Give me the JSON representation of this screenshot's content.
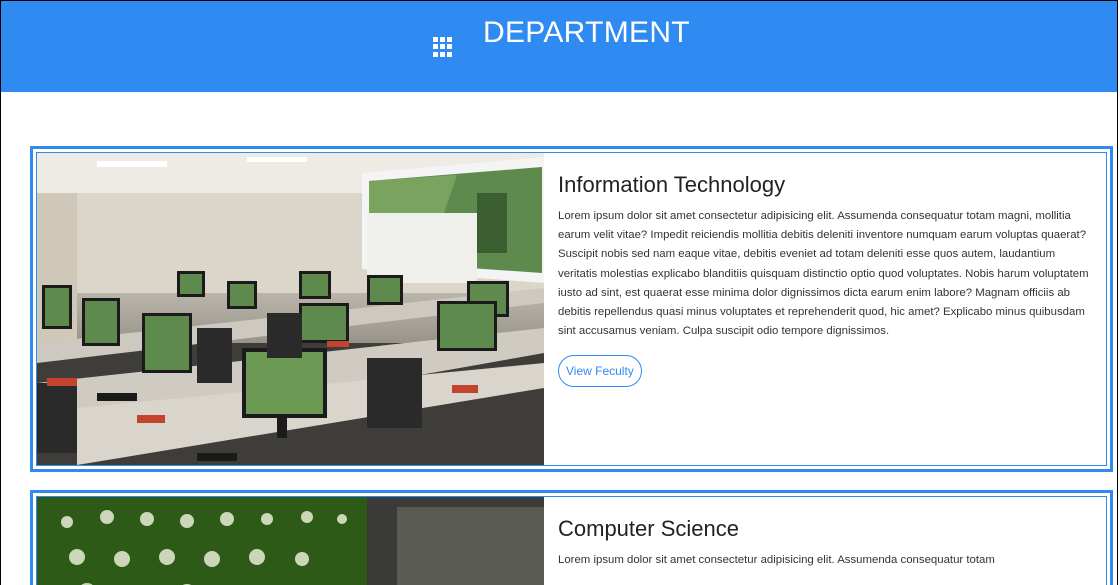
{
  "header": {
    "title": "DEPARTMENT",
    "icon": "apps-grid-icon",
    "background_color": "#2f8bf2"
  },
  "departments": [
    {
      "title": "Information Technology",
      "description": "Lorem ipsum dolor sit amet consectetur adipisicing elit. Assumenda consequatur totam magni, mollitia earum velit vitae? Impedit reiciendis mollitia debitis deleniti inventore numquam earum voluptas quaerat? Suscipit nobis sed nam eaque vitae, debitis eveniet ad totam deleniti esse quos autem, laudantium veritatis molestias explicabo blanditiis quisquam distinctio optio quod voluptates. Nobis harum voluptatem iusto ad sint, est quaerat esse minima dolor dignissimos dicta earum enim labore? Magnam officiis ab debitis repellendus quasi minus voluptates et reprehenderit quod, hic amet? Explicabo minus quibusdam sint accusamus veniam. Culpa suscipit odio tempore dignissimos.",
      "button_label": "View Feculty",
      "photo": "computer-lab-photo"
    },
    {
      "title": "Computer Science",
      "description": "Lorem ipsum dolor sit amet consectetur adipisicing elit. Assumenda consequatur totam",
      "photo": "circuit-board-photo"
    }
  ],
  "colors": {
    "accent": "#2f8bf2",
    "text": "#333333"
  }
}
